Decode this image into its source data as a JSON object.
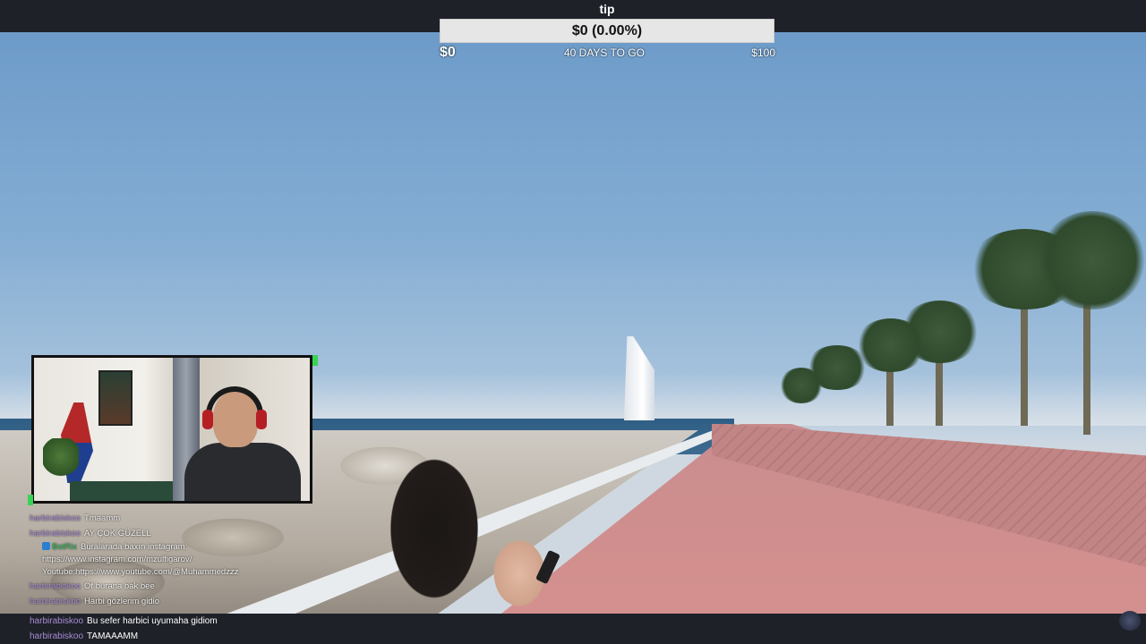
{
  "goal": {
    "title": "tip",
    "progress_text": "$0 (0.00%)",
    "progress_fraction": 0,
    "current_amount": "$0",
    "days_left": "40 DAYS TO GO",
    "target_amount": "$100",
    "fill_color": "#4caf50"
  },
  "chat": {
    "messages": [
      {
        "user": "harbirabiskoo",
        "text": "Tmaamm"
      },
      {
        "user": "harbirabiskoo",
        "text": "AY ÇOK GÜZELL"
      },
      {
        "user": "BotRix",
        "text": "Buralarada baxın instagram: https://www.instagram.com/mzulfigarov/ Youtube:https://www.youtube.com/@Muhammedzzz"
      },
      {
        "user": "harbirabiskoo",
        "text": "Of burana bak bee"
      },
      {
        "user": "harbirabiskoo",
        "text": "Harbi gözlerim gidio"
      },
      {
        "user": "harbirabiskoo",
        "text": "Bu sefer harbici uyumaha gidiom"
      },
      {
        "user": "harbirabiskoo",
        "text": "TAMAAAMM"
      }
    ]
  },
  "icons": {
    "corner": "overlay-logo-icon"
  }
}
